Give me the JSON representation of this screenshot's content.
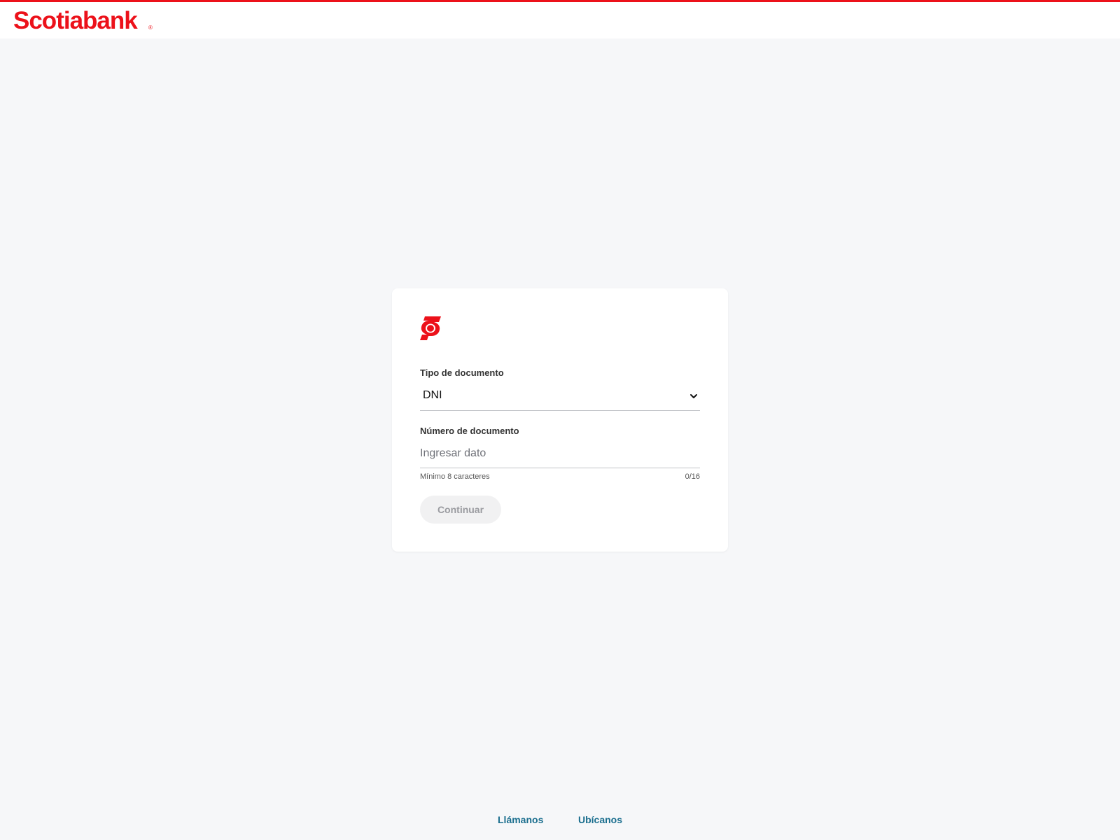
{
  "header": {
    "brand_name": "Scotiabank",
    "brand_registered_mark": "®",
    "logo_icon": "scotiabank-wordmark"
  },
  "colors": {
    "brand_red": "#ec111a",
    "page_background": "#f6f7f9",
    "link_color": "#1a6e8e",
    "disabled_button_bg": "#f1f1f2",
    "disabled_button_text": "#9a9ba0"
  },
  "form": {
    "logo_icon": "scotiabank-s-flag-icon",
    "document_type": {
      "label": "Tipo de documento",
      "selected_value": "DNI",
      "icon": "chevron-down-icon"
    },
    "document_number": {
      "label": "Número de documento",
      "placeholder": "Ingresar dato",
      "value": "",
      "helper_text": "Mínimo 8 caracteres",
      "counter": "0/16"
    },
    "continue_button": {
      "label": "Continuar",
      "state": "disabled"
    }
  },
  "footer": {
    "links": [
      {
        "label": "Llámanos"
      },
      {
        "label": "Ubícanos"
      }
    ]
  }
}
